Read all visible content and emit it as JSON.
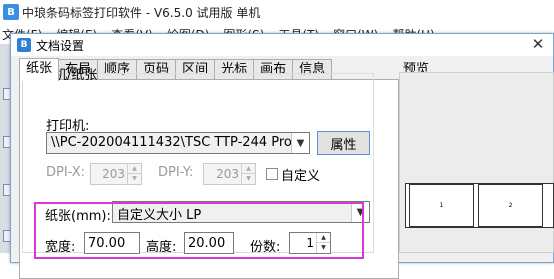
{
  "app": {
    "title": "中琅条码标签打印软件 - V6.5.0 试用版 单机",
    "icon_text": "B",
    "menu": [
      "文件(F)",
      "编辑(E)",
      "查看(V)",
      "绘图(D)",
      "图形(S)",
      "工具(T)",
      "窗口(W)",
      "帮助(H)"
    ]
  },
  "dialog": {
    "title": "文档设置",
    "icon_text": "B",
    "close_glyph": "✕",
    "tabs": [
      "纸张",
      "布局",
      "顺序",
      "页码",
      "区间",
      "光标",
      "画布",
      "信息"
    ],
    "active_tab": "纸张"
  },
  "printer_group": {
    "title": "打印机/纸张",
    "printer_label": "打印机:",
    "printer_value": "\\\\PC-202004111432\\TSC TTP-244 Pro",
    "properties_button": "属性",
    "dpi_x_label": "DPI-X:",
    "dpi_x_value": "203",
    "dpi_y_label": "DPI-Y:",
    "dpi_y_value": "203",
    "custom_label": "自定义",
    "custom_checked": false,
    "paper_label": "纸张(mm):",
    "paper_value": "自定义大小 LP",
    "width_label": "宽度:",
    "width_value": "70.00",
    "height_label": "高度:",
    "height_value": "20.00",
    "copies_label": "份数:",
    "copies_value": "1"
  },
  "preview": {
    "title": "预览",
    "cells": [
      "1",
      "2"
    ]
  },
  "colors": {
    "highlight": "#d63ad4",
    "button_border": "#5b8fd9"
  },
  "icons": {
    "dropdown": "chevron-down-icon",
    "spin": "spin-arrows-icon"
  }
}
